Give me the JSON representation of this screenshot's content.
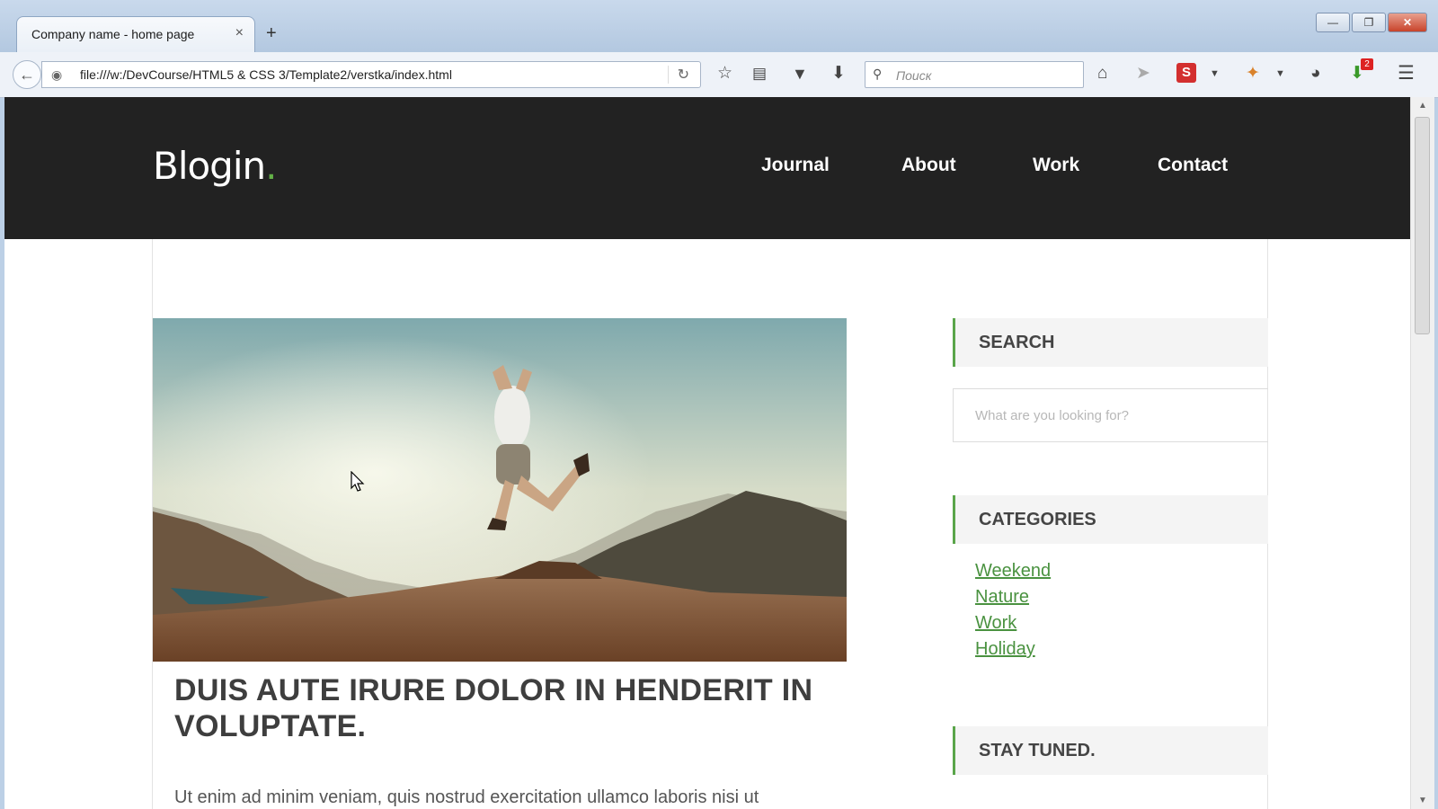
{
  "browser": {
    "tab_title": "Company name - home page",
    "tab_close": "×",
    "new_tab": "+",
    "url": "file:///w:/DevCourse/HTML5 & CSS 3/Template2/verstka/index.html",
    "search_placeholder": "Поиск",
    "notification_count": "2",
    "window_buttons": {
      "minimize": "—",
      "maximize": "❐",
      "close": "✕"
    },
    "icons": [
      "back-icon",
      "globe-icon",
      "reload-icon",
      "bookmark-star-icon",
      "reading-list-icon",
      "pocket-icon",
      "download-icon",
      "home-icon",
      "send-icon",
      "s-extension-icon",
      "extension-icon",
      "chat-icon",
      "download-manager-icon",
      "menu-icon"
    ]
  },
  "site": {
    "logo": "Blogin",
    "logo_dot": ".",
    "nav": [
      "Journal",
      "About",
      "Work",
      "Contact"
    ],
    "post": {
      "title": "DUIS AUTE IRURE DOLOR IN HENDERIT IN VOLUPTATE.",
      "excerpt": "Ut enim ad minim veniam, quis nostrud exercitation ullamco laboris nisi ut"
    },
    "sidebar": {
      "search_title": "SEARCH",
      "search_placeholder": "What are you looking for?",
      "categories_title": "CATEGORIES",
      "categories": [
        "Weekend",
        "Nature",
        "Work",
        "Holiday"
      ],
      "stay_tuned_title": "STAY TUNED."
    },
    "colors": {
      "header_bg": "#222222",
      "accent": "#5aa54a",
      "link": "#4a9240"
    }
  }
}
